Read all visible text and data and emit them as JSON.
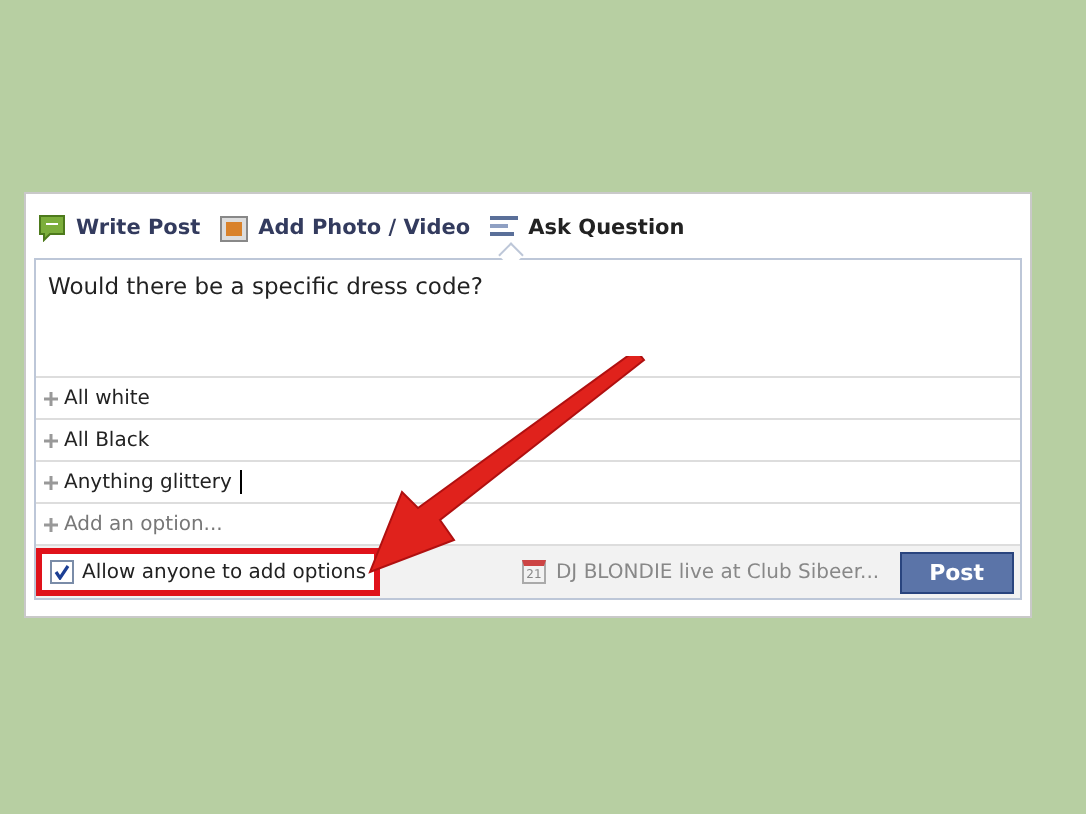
{
  "tabs": [
    {
      "label": "Write Post",
      "kind": "status",
      "selected": false
    },
    {
      "label": "Add Photo / Video",
      "kind": "photo",
      "selected": false
    },
    {
      "label": "Ask Question",
      "kind": "question",
      "selected": true
    }
  ],
  "question": {
    "value": "Would there be a specific dress code?"
  },
  "options": [
    {
      "value": "All white",
      "focused": false
    },
    {
      "value": "All Black",
      "focused": false
    },
    {
      "value": "Anything glittery",
      "focused": true
    }
  ],
  "new_option": {
    "placeholder": "Add an option..."
  },
  "allow_options": {
    "label": "Allow anyone to add options",
    "checked": true
  },
  "event": {
    "date": "21",
    "label": "DJ BLONDIE live at Club Sibeer..."
  },
  "post_button": "Post"
}
